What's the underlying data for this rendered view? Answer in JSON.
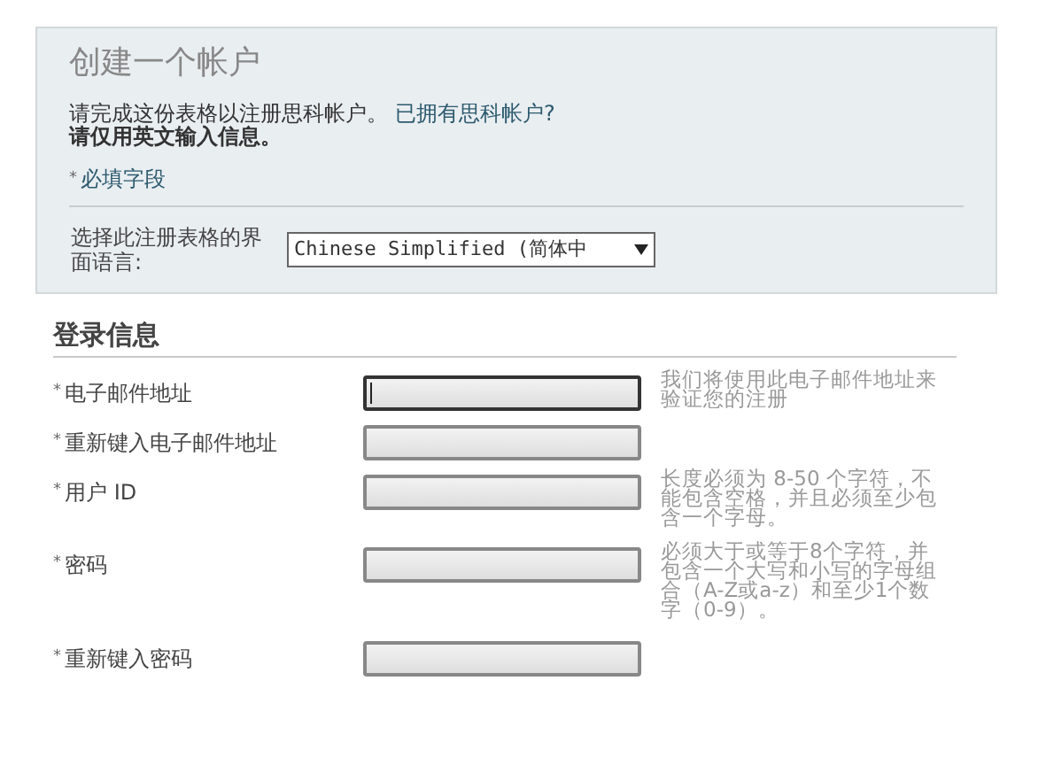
{
  "intro": {
    "title": "创建一个帐户",
    "description": "请完成这份表格以注册思科帐户。",
    "link": "已拥有思科帐户?",
    "note": "请仅用英文输入信息。",
    "required_marker": "*",
    "required_note": "必填字段",
    "language_label": "选择此注册表格的界面语言:",
    "language_value": "Chinese Simplified (简体中"
  },
  "section": {
    "title": "登录信息",
    "fields": [
      {
        "marker": "*",
        "label": "电子邮件地址",
        "focused": true,
        "hint": "我们将使用此电子邮件地址来验证您的注册"
      },
      {
        "marker": "*",
        "label": "重新键入电子邮件地址",
        "focused": false
      },
      {
        "marker": "*",
        "label": "用户 ID",
        "focused": false,
        "hint": "长度必须为 8-50 个字符，不能包含空格，并且必须至少包含一个字母。"
      },
      {
        "marker": "*",
        "label": "密码",
        "focused": false,
        "hint": "必须大于或等于8个字符，并包含一个大写和小写的字母组合（A-Z或a-z）和至少1个数字（0-9）。"
      },
      {
        "marker": "*",
        "label": "重新键入密码",
        "focused": false
      }
    ]
  }
}
